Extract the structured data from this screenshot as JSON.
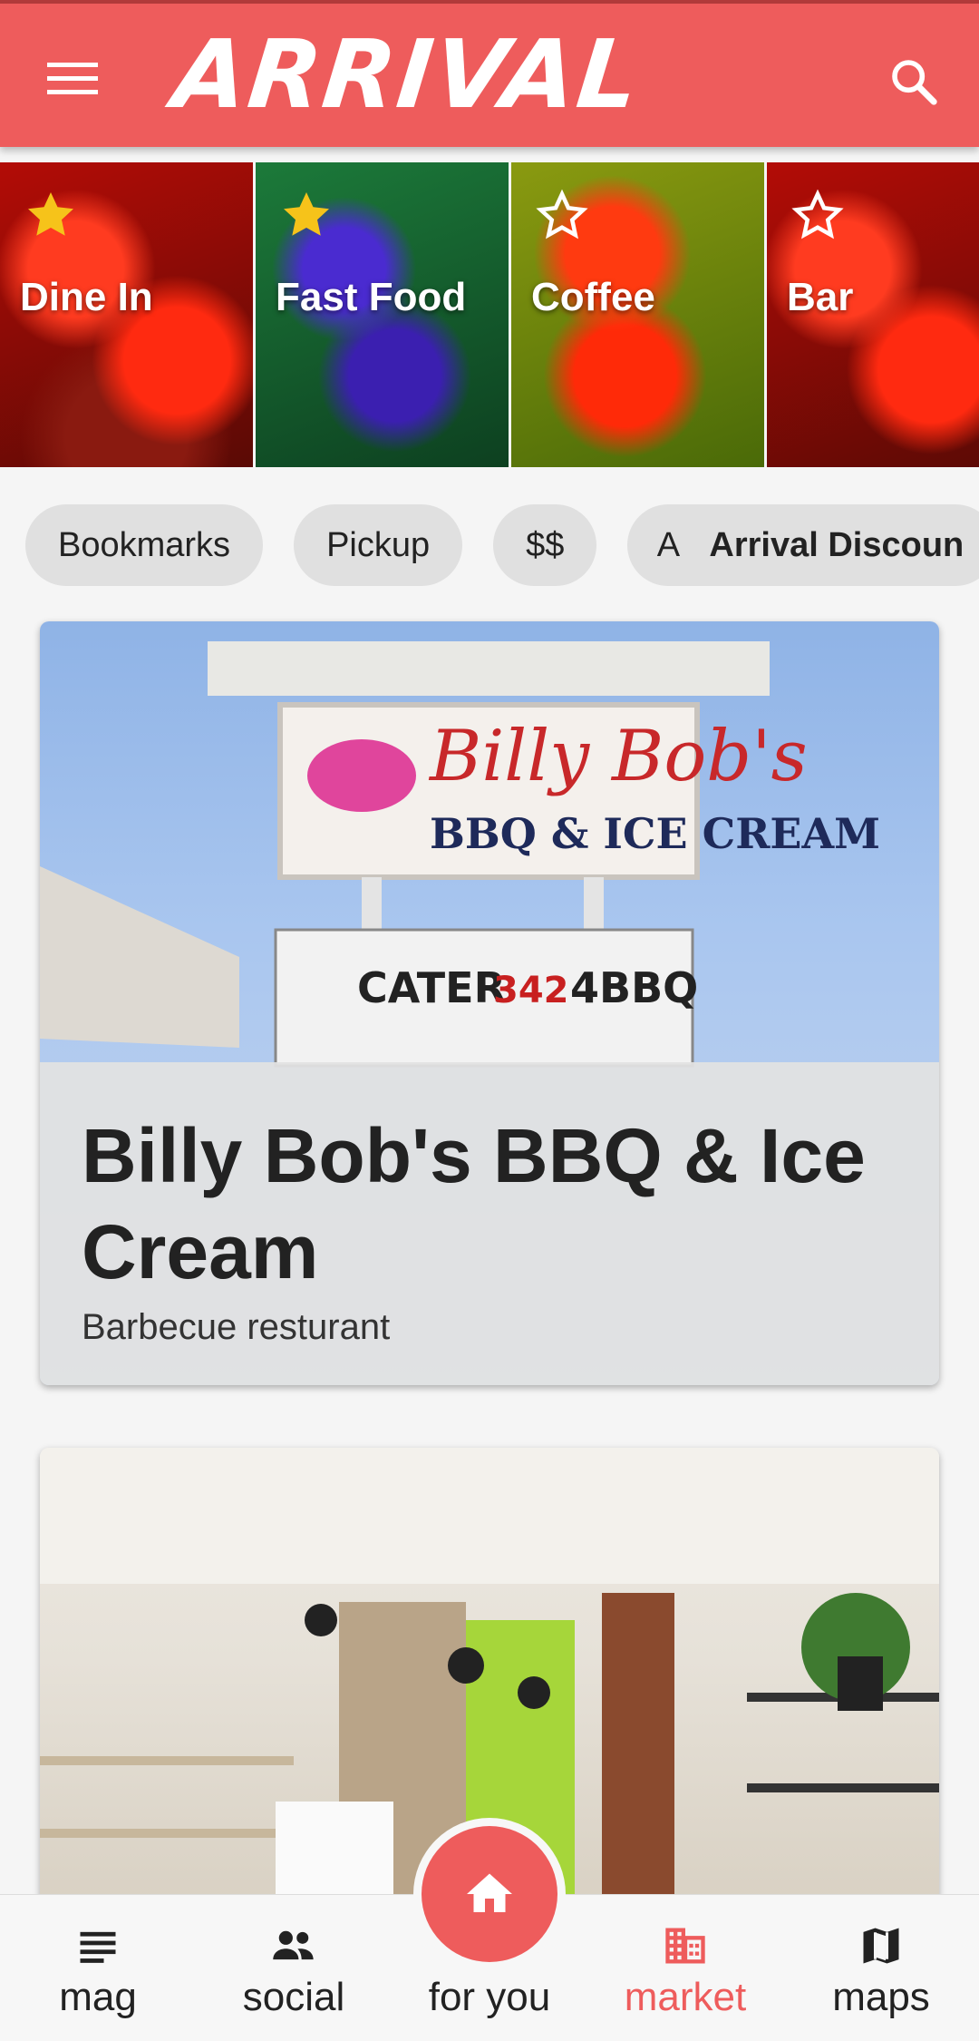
{
  "app": {
    "brand": "ARRIVAL"
  },
  "colors": {
    "accent": "#ee5c5c",
    "text": "#222222",
    "chip_bg": "#e0e0e0"
  },
  "header": {
    "menu_icon": "menu-icon",
    "search_icon": "search-icon"
  },
  "categories": [
    {
      "label": "Dine In",
      "starred": true
    },
    {
      "label": "Fast Food",
      "starred": true
    },
    {
      "label": "Coffee",
      "starred": false
    },
    {
      "label": "Bar",
      "starred": false
    }
  ],
  "filters": {
    "chips": [
      "Bookmarks",
      "Pickup",
      "$$"
    ],
    "discount_avatar": "A",
    "discount_label": "Arrival Discoun"
  },
  "listings": [
    {
      "title": "Billy Bob's BBQ & Ice Cream",
      "subtitle": "Barbecue resturant"
    },
    {
      "title": "",
      "subtitle": ""
    }
  ],
  "bottom_nav": {
    "items": [
      {
        "label": "mag",
        "icon": "article-icon"
      },
      {
        "label": "social",
        "icon": "people-icon"
      },
      {
        "label": "for you",
        "icon": "home-icon"
      },
      {
        "label": "market",
        "icon": "business-icon",
        "active": true
      },
      {
        "label": "maps",
        "icon": "map-icon"
      }
    ]
  }
}
